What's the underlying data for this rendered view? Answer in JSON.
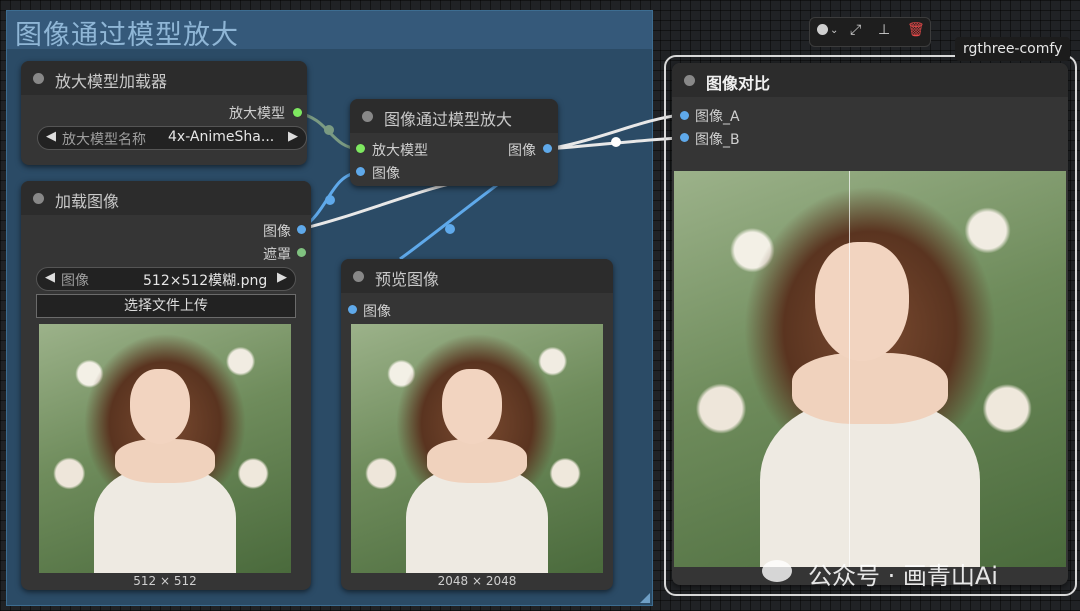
{
  "group": {
    "title": "图像通过模型放大"
  },
  "nodes": {
    "upscale_loader": {
      "title": "放大模型加载器",
      "output_label": "放大模型",
      "widget_label": "放大模型名称",
      "widget_value": "4x-AnimeSha..."
    },
    "load_image": {
      "title": "加载图像",
      "output_image_label": "图像",
      "output_mask_label": "遮罩",
      "widget_label": "图像",
      "widget_value": "512×512模糊.png",
      "upload_label": "选择文件上传",
      "caption": "512 × 512"
    },
    "upscale_with_model": {
      "title": "图像通过模型放大",
      "input_model_label": "放大模型",
      "input_image_label": "图像",
      "output_label": "图像"
    },
    "preview": {
      "title": "预览图像",
      "input_label": "图像",
      "caption": "2048 × 2048"
    },
    "compare": {
      "title": "图像对比",
      "input_a": "图像_A",
      "input_b": "图像_B"
    }
  },
  "toolbar": {
    "icons": [
      "color-circle-icon",
      "chevron-down-icon",
      "wand-icon",
      "pin-icon",
      "trash-icon"
    ]
  },
  "brand_tag": "rgthree-comfy",
  "watermark": "公众号 · 画青山Ai",
  "colors": {
    "canvas": "#202225",
    "group": "#2b4b66",
    "node": "#353535",
    "model_link": "#7a9a82",
    "image_link": "#5fa9ea",
    "white_link": "#e8e8e8",
    "delete": "#e84a4a"
  }
}
